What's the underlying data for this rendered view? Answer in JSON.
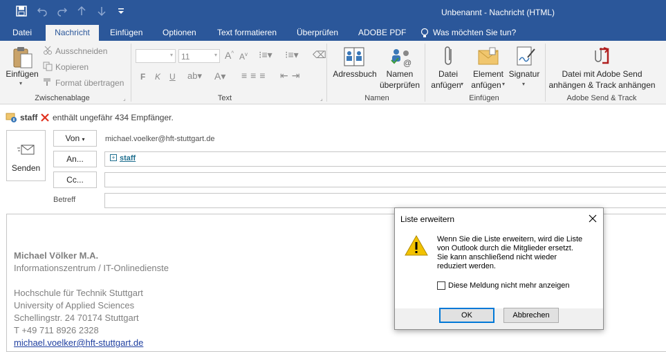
{
  "window": {
    "title": "Unbenannt - Nachricht (HTML)"
  },
  "quick_access": {
    "icons": [
      "save-icon",
      "undo-icon",
      "redo-icon",
      "up-arrow-icon",
      "down-arrow-icon",
      "customize-icon"
    ]
  },
  "tabs": [
    {
      "label": "Datei"
    },
    {
      "label": "Nachricht"
    },
    {
      "label": "Einfügen"
    },
    {
      "label": "Optionen"
    },
    {
      "label": "Text formatieren"
    },
    {
      "label": "Überprüfen"
    },
    {
      "label": "ADOBE PDF"
    },
    {
      "label": "Was möchten Sie tun?"
    }
  ],
  "ribbon": {
    "clipboard": {
      "group": "Zwischenablage",
      "paste": "Einfügen",
      "cut": "Ausschneiden",
      "copy": "Kopieren",
      "format_painter": "Format übertragen"
    },
    "text": {
      "group": "Text",
      "font_size": "11",
      "bold": "F",
      "italic": "K",
      "underline": "U"
    },
    "names": {
      "group": "Namen",
      "address_book": "Adressbuch",
      "check_names_1": "Namen",
      "check_names_2": "überprüfen"
    },
    "include": {
      "group": "Einfügen",
      "attach_file_1": "Datei",
      "attach_file_2": "anfügen",
      "attach_item_1": "Element",
      "attach_item_2": "anfügen",
      "signature": "Signatur"
    },
    "adobe": {
      "group": "Adobe Send & Track",
      "line1": "Datei mit Adobe Send",
      "line2": "anhängen & Track anhängen"
    }
  },
  "infobar": {
    "name": "staff",
    "text": "enthält ungefähr 434 Empfänger."
  },
  "compose": {
    "send": "Senden",
    "from_button": "Von",
    "from_value": "michael.voelker@hft-stuttgart.de",
    "to_button": "An...",
    "to_value": "staff",
    "cc_button": "Cc...",
    "subject_label": "Betreff"
  },
  "signature": {
    "name": "Michael Völker M.A.",
    "dept": "Informationszentrum / IT-Onlinedienste",
    "school": "Hochschule für Technik Stuttgart",
    "school_en": "University of Applied Sciences",
    "address": "Schellingstr. 24   70174 Stuttgart",
    "phone": "T +49 711 8926 2328",
    "email": "michael.voelker@hft-stuttgart.de"
  },
  "dialog": {
    "title": "Liste erweitern",
    "line1": "Wenn Sie die Liste erweitern, wird die Liste",
    "line2": "von Outlook durch die Mitglieder ersetzt.",
    "line3": "Sie kann anschließend nicht wieder",
    "line4": "reduziert werden.",
    "checkbox": "Diese Meldung nicht mehr anzeigen",
    "ok": "OK",
    "cancel": "Abbrechen"
  },
  "colors": {
    "brand": "#2b579a",
    "link": "#1f5c99",
    "warning": "#f2c200",
    "error": "#e0301e"
  }
}
